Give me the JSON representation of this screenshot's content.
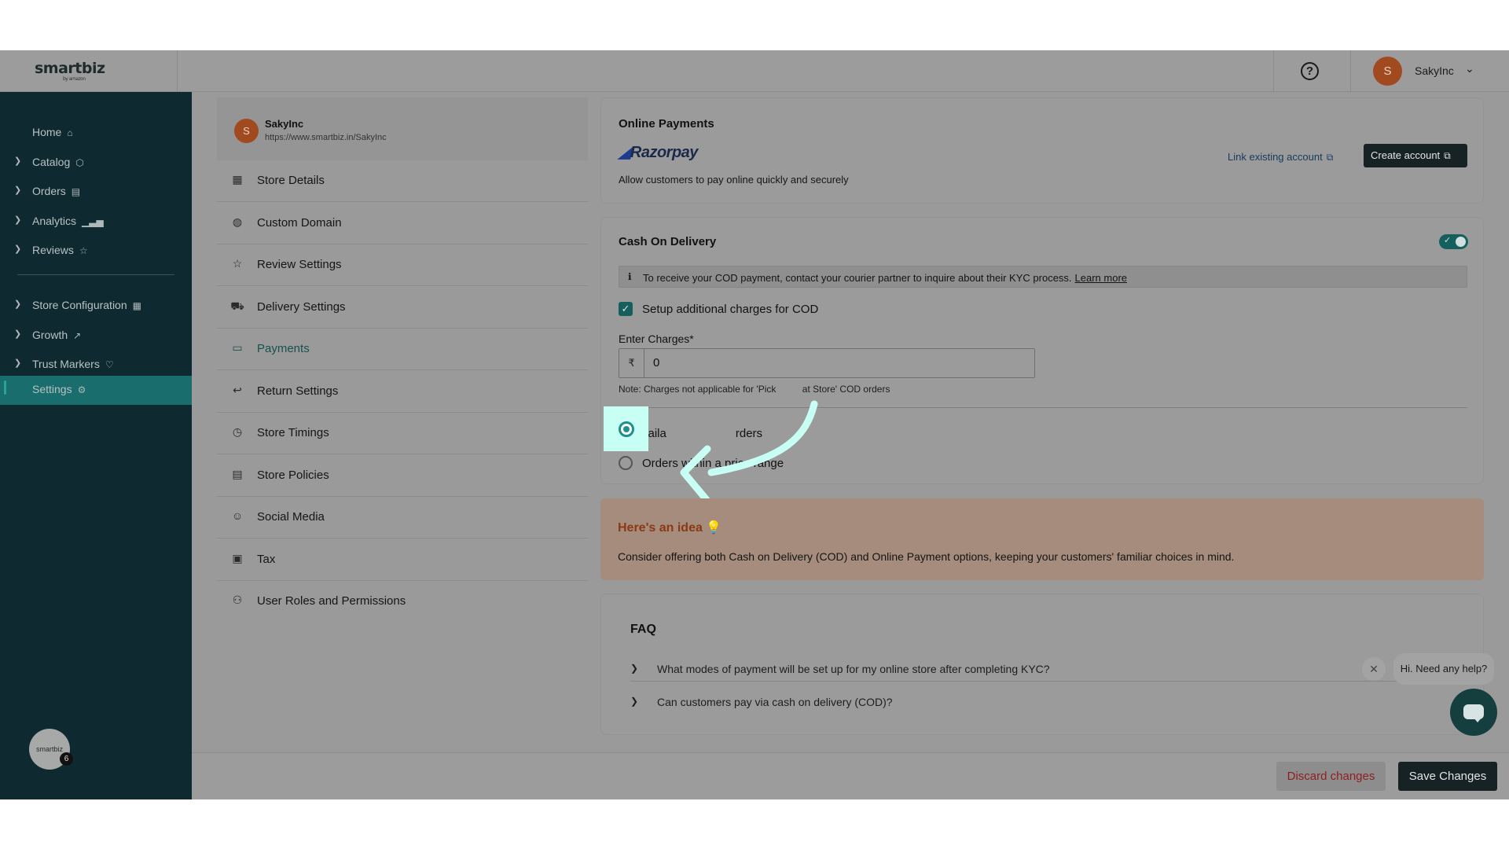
{
  "brand": {
    "logo_text": "smartbiz",
    "logo_sub": "by amazon"
  },
  "header": {
    "help_icon": "help-circle-icon",
    "user_initial": "S",
    "user_name": "SakyInc"
  },
  "sidebar": {
    "items": [
      {
        "label": "Home",
        "icon": "⌂"
      },
      {
        "label": "Catalog",
        "icon": "⬡"
      },
      {
        "label": "Orders",
        "icon": "▤"
      },
      {
        "label": "Analytics",
        "icon": "▁▃▅"
      },
      {
        "label": "Reviews",
        "icon": "☆"
      },
      {
        "label": "Store Configuration",
        "icon": "▦"
      },
      {
        "label": "Growth",
        "icon": "↗"
      },
      {
        "label": "Trust Markers",
        "icon": "♡"
      },
      {
        "label": "Settings",
        "icon": "⚙"
      }
    ],
    "bottom_avatar_text": "smartbiz",
    "bottom_badge": "6"
  },
  "settings_menu": {
    "store_initial": "S",
    "store_name": "SakyInc",
    "store_url": "https://www.smartbiz.in/SakyInc",
    "items": [
      {
        "label": "Store Details",
        "icon": "▦"
      },
      {
        "label": "Custom Domain",
        "icon": "◍"
      },
      {
        "label": "Review Settings",
        "icon": "☆"
      },
      {
        "label": "Delivery Settings",
        "icon": "⛟"
      },
      {
        "label": "Payments",
        "icon": "▭"
      },
      {
        "label": "Return Settings",
        "icon": "↩"
      },
      {
        "label": "Store Timings",
        "icon": "◷"
      },
      {
        "label": "Store Policies",
        "icon": "▤"
      },
      {
        "label": "Social Media",
        "icon": "☺"
      },
      {
        "label": "Tax",
        "icon": "▣"
      },
      {
        "label": "User Roles and Permissions",
        "icon": "⚇"
      }
    ]
  },
  "online_payments": {
    "title": "Online Payments",
    "provider": "Razorpay",
    "description": "Allow customers to pay online quickly and securely",
    "link_existing": "Link existing account",
    "create_account": "Create account"
  },
  "cod": {
    "title": "Cash On Delivery",
    "enabled": true,
    "info_text": "To receive your COD payment, contact your courier partner to inquire about their KYC process.",
    "learn_more": "Learn more",
    "setup_charges_label": "Setup additional charges for COD",
    "setup_charges_checked": true,
    "enter_charges_label": "Enter Charges*",
    "currency_symbol": "₹",
    "charges_value": "0",
    "note": "Note: Charges not applicable for 'Pick up at Store' COD orders",
    "option_all_label": "Available for all orders",
    "option_all_visible": "vaila",
    "option_all_visible_end": "rders",
    "option_range_label": "Orders within a price range",
    "selected_option": "all"
  },
  "idea": {
    "title": "Here's an idea",
    "text": "Consider offering both Cash on Delivery (COD) and Online Payment options, keeping your customers' familiar choices in mind."
  },
  "faq": {
    "title": "FAQ",
    "items": [
      "What modes of payment will be set up for my online store after completing KYC?",
      "Can customers pay via cash on delivery (COD)?"
    ]
  },
  "chat": {
    "greeting": "Hi. Need any help?",
    "close_icon": "close-icon"
  },
  "footer": {
    "discard": "Discard changes",
    "save": "Save Changes"
  }
}
